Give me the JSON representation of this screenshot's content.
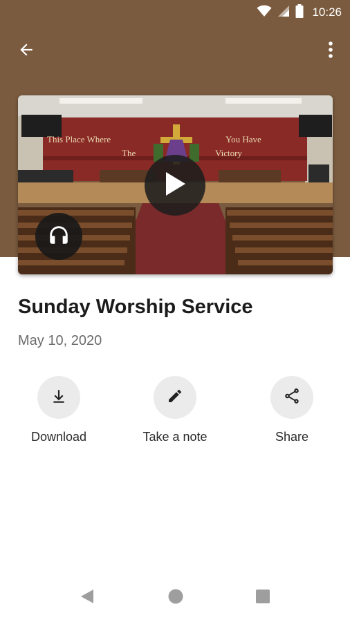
{
  "status_bar": {
    "time": "10:26",
    "icons": [
      "wifi-icon",
      "signal-icon",
      "battery-icon"
    ]
  },
  "app_bar": {
    "back_icon": "arrow-back-icon",
    "menu_icon": "more-vert-icon"
  },
  "media": {
    "thumbnail_sign_left": "This Place Where",
    "thumbnail_sign_left_line2": "The",
    "thumbnail_sign_right": "You Have",
    "thumbnail_sign_right_line2": "Victory",
    "play_icon": "play-icon",
    "audio_icon": "headphones-icon"
  },
  "sermon": {
    "title": "Sunday Worship Service",
    "date": "May 10, 2020"
  },
  "actions": [
    {
      "label": "Download",
      "icon": "download-icon"
    },
    {
      "label": "Take a note",
      "icon": "pencil-icon"
    },
    {
      "label": "Share",
      "icon": "share-icon"
    }
  ],
  "colors": {
    "header_brown": "#7a5b3f",
    "action_circle": "#ebebeb",
    "title_text": "#1b1b1b",
    "date_text": "#6b6b6b"
  },
  "nav": {
    "icons": [
      "nav-back-icon",
      "nav-home-icon",
      "nav-recents-icon"
    ]
  }
}
